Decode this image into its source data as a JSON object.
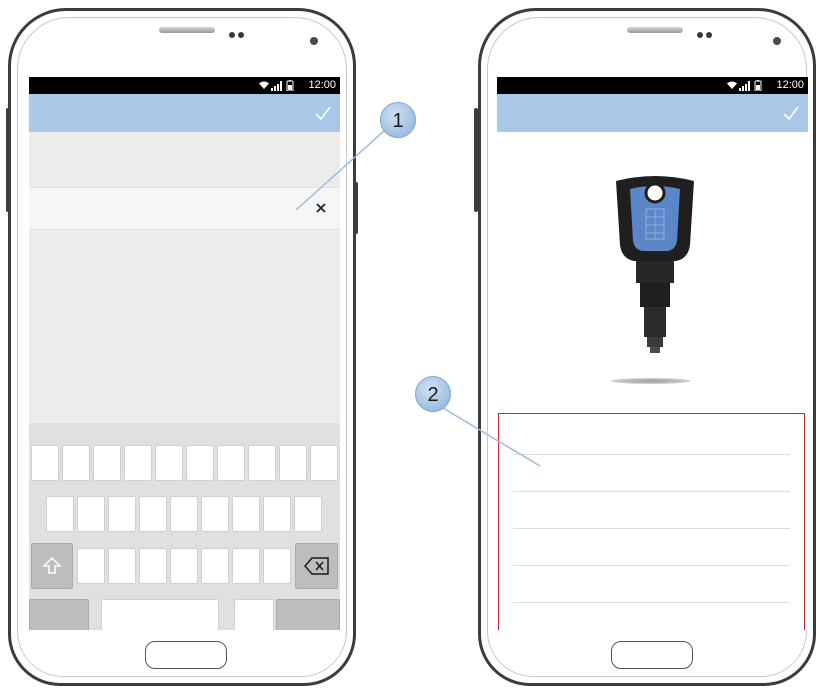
{
  "left_phone": {
    "status_time": "12:00",
    "done_icon": "check-icon",
    "clear_icon": "close-icon",
    "keyboard": {
      "shift_icon": "shift-arrow-icon",
      "backspace_icon": "backspace-icon"
    }
  },
  "right_phone": {
    "status_time": "12:00",
    "done_icon": "check-icon",
    "key_image": "security-key-image"
  },
  "callouts": [
    "1",
    "2"
  ],
  "colors": {
    "action_bar": "#a9c8e8",
    "highlight_box": "#d0242c",
    "callout_fill": "#a5c4e4",
    "key_body": "#1f1f1f",
    "key_accent": "#5b86c8"
  }
}
